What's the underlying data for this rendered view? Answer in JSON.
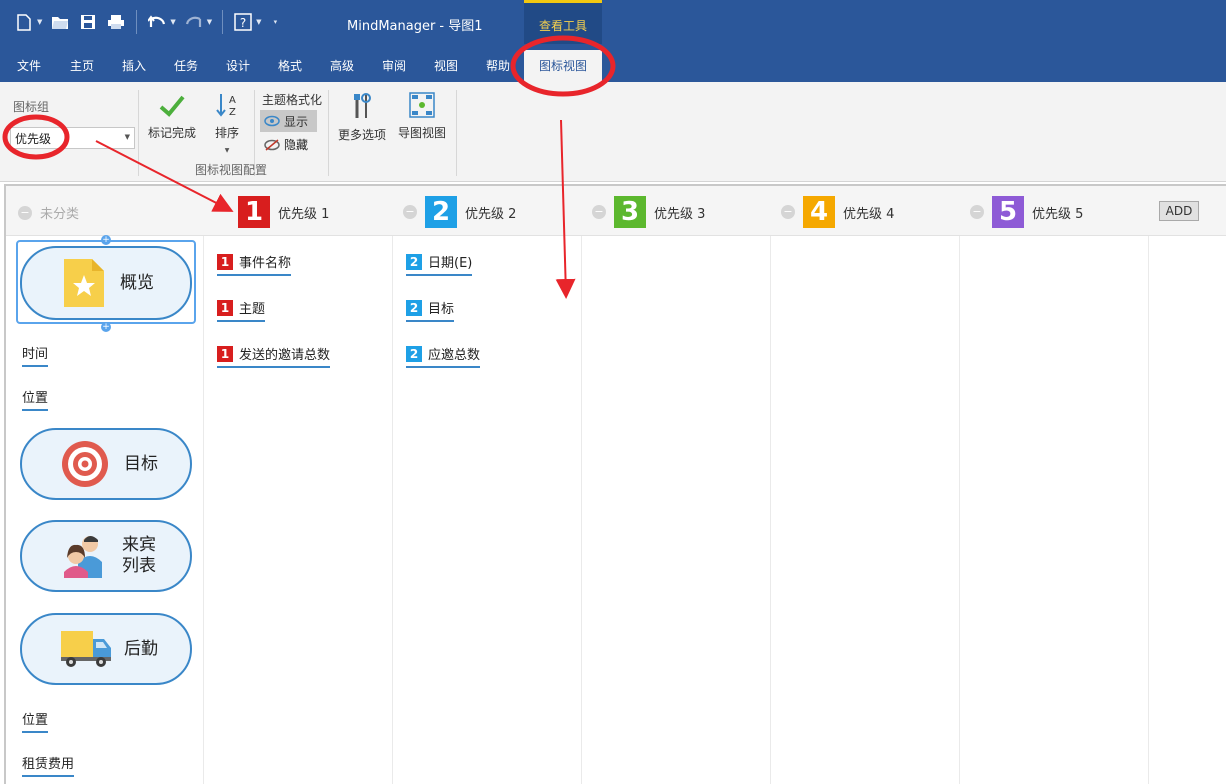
{
  "app": {
    "title": "MindManager - 导图1",
    "context_tab_group": "查看工具"
  },
  "qat": {
    "icons": [
      "new-doc-icon",
      "open-folder-icon",
      "save-icon",
      "print-icon",
      "undo-icon",
      "redo-icon",
      "help-icon",
      "customize-icon"
    ]
  },
  "tabs": [
    {
      "label": "文件"
    },
    {
      "label": "主页"
    },
    {
      "label": "插入"
    },
    {
      "label": "任务"
    },
    {
      "label": "设计"
    },
    {
      "label": "格式"
    },
    {
      "label": "高级"
    },
    {
      "label": "审阅"
    },
    {
      "label": "视图"
    },
    {
      "label": "帮助"
    },
    {
      "label": "图标视图"
    }
  ],
  "ribbon": {
    "icon_group_label": "图标组",
    "icon_group_value": "优先级",
    "mark_done": "标记完成",
    "sort": "排序",
    "topic_format": "主题格式化",
    "show": "显示",
    "hide": "隐藏",
    "more_options": "更多选项",
    "map_view": "导图视图",
    "group_label": "图标视图配置"
  },
  "columns": {
    "uncategorized": "未分类",
    "headers": [
      {
        "num": "1",
        "name": "优先级 1",
        "color": "#d81e1e"
      },
      {
        "num": "2",
        "name": "优先级 2",
        "color": "#1ea0e6"
      },
      {
        "num": "3",
        "name": "优先级 3",
        "color": "#5cb82e"
      },
      {
        "num": "4",
        "name": "优先级 4",
        "color": "#f5a800"
      },
      {
        "num": "5",
        "name": "优先级 5",
        "color": "#8e5bd6"
      }
    ],
    "add": "ADD"
  },
  "uncat_topics": {
    "overview": "概览",
    "time": "时间",
    "location": "位置",
    "goal": "目标",
    "guest_line1": "来宾",
    "guest_line2": "列表",
    "logistics": "后勤",
    "location2": "位置",
    "rent": "租赁费用"
  },
  "p1_topics": [
    "事件名称",
    "主题",
    "发送的邀请总数"
  ],
  "p2_topics": [
    "日期(E)",
    "目标",
    "应邀总数"
  ],
  "colors": {
    "titlebar": "#2b579a",
    "annotation": "#e8252b",
    "topic_border": "#3a87c8"
  }
}
